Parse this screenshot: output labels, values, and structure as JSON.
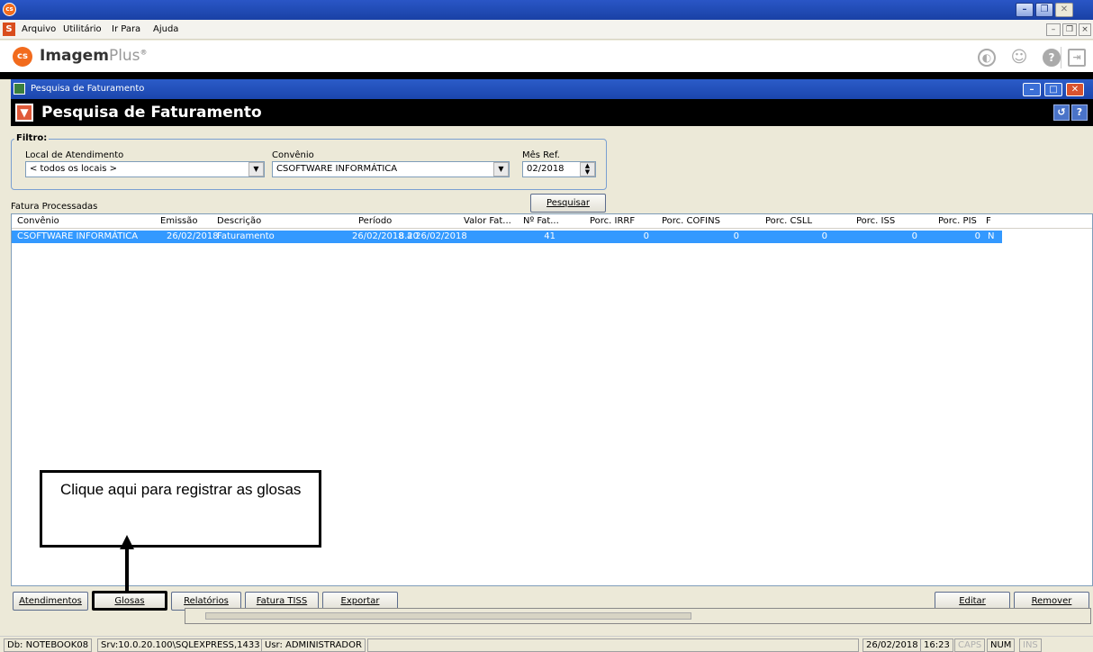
{
  "menu": {
    "items": [
      {
        "label": "Arquivo"
      },
      {
        "label": "Utilitário"
      },
      {
        "label": "Ir Para"
      },
      {
        "label": "Ajuda"
      }
    ]
  },
  "brand": {
    "name": "Imagem",
    "suffix": "Plus",
    "reg": "®",
    "logo_text": "cs"
  },
  "child_window": {
    "title": "Pesquisa de Faturamento"
  },
  "form": {
    "title": "Pesquisa de Faturamento"
  },
  "filter": {
    "label": "Filtro:",
    "local_label": "Local de Atendimento",
    "local_value": "< todos os locais >",
    "convenio_label": "Convênio",
    "convenio_value": "CSOFTWARE INFORMÁTICA",
    "mes_label": "Mês Ref.",
    "mes_value": "02/2018"
  },
  "search_button": "Pesquisar",
  "grid": {
    "caption": "Fatura Processadas",
    "columns": [
      "Convênio",
      "Emissão",
      "Descrição",
      "Período",
      "Valor Fat...",
      "Nº Fat...",
      "Porc. IRRF",
      "Porc. COFINS",
      "Porc. CSLL",
      "Porc. ISS",
      "Porc. PIS",
      "F"
    ],
    "rows": [
      {
        "convenio": "CSOFTWARE INFORMÁTICA",
        "emissao": "26/02/2018",
        "descricao": "Faturamento",
        "periodo": "26/02/2018 a 26/02/2018",
        "valor": "8.20",
        "num": "41",
        "irrf": "0",
        "cofins": "0",
        "csll": "0",
        "iss": "0",
        "pis": "0",
        "f": "N"
      }
    ]
  },
  "callout": {
    "text": "Clique aqui para registrar as glosas"
  },
  "buttons": {
    "atendimentos": "Atendimentos",
    "glosas": "Glosas",
    "relatorios": "Relatórios",
    "fatura_tiss": "Fatura TISS",
    "exportar": "Exportar",
    "editar": "Editar",
    "remover": "Remover"
  },
  "status": {
    "db": "Db: NOTEBOOK08",
    "srv": "Srv:10.0.20.100\\SQLEXPRESS,1433",
    "usr": "Usr: ADMINISTRADOR",
    "date": "26/02/2018",
    "time": "16:23",
    "caps": "CAPS",
    "num": "NUM",
    "ins": "INS"
  },
  "colors": {
    "accent": "#1b46ad",
    "selection": "#3399ff"
  }
}
